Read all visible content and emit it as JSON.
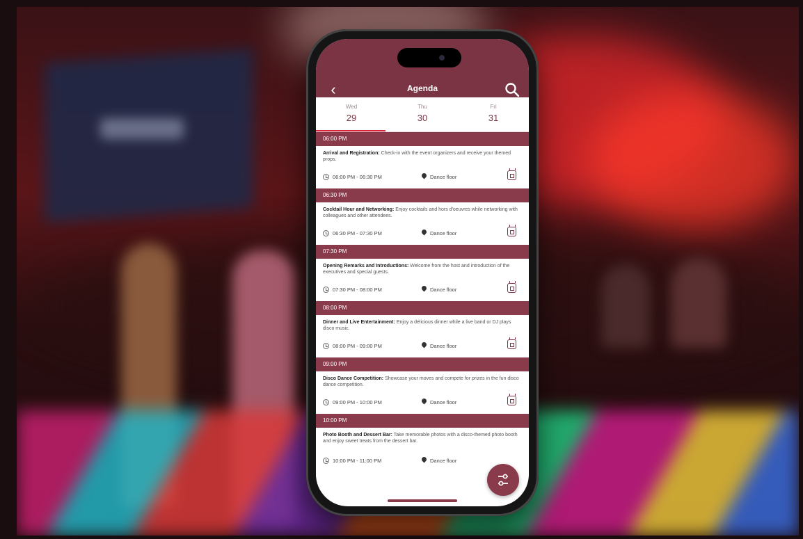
{
  "app": {
    "title": "Agenda",
    "accent_color": "#7a3443",
    "section_color": "#8a3b4b",
    "icons": {
      "back": "chevron-left-icon",
      "search": "search-icon",
      "clock": "clock-icon",
      "location": "location-pin-icon",
      "calendar": "calendar-add-icon",
      "fab": "filter-sliders-icon"
    }
  },
  "days": [
    {
      "name": "Wed",
      "date": "29",
      "active": true
    },
    {
      "name": "Thu",
      "date": "30",
      "active": false
    },
    {
      "name": "Fri",
      "date": "31",
      "active": false
    }
  ],
  "agenda": [
    {
      "header": "06:00 PM",
      "title": "Arrival and Registration:",
      "desc": "Check-in with the event organizers and receive your themed props.",
      "time": "06:00 PM - 06:30 PM",
      "location": "Dance floor"
    },
    {
      "header": "06:30 PM",
      "title": "Cocktail Hour and Networking:",
      "desc": "Enjoy cocktails and hors d'oeuvres while networking with colleagues and other attendees.",
      "time": "06:30 PM - 07:30 PM",
      "location": "Dance floor"
    },
    {
      "header": "07:30 PM",
      "title": "Opening Remarks and Introductions:",
      "desc": "Welcome from the host and introduction of the executives and special guests.",
      "time": "07:30 PM - 08:00 PM",
      "location": "Dance floor"
    },
    {
      "header": "08:00 PM",
      "title": "Dinner and Live Entertainment:",
      "desc": "Enjoy a delicious dinner while a live band or DJ plays disco music.",
      "time": "08:00 PM - 09:00 PM",
      "location": "Dance floor"
    },
    {
      "header": "09:00 PM",
      "title": "Disco Dance Competition:",
      "desc": "Showcase your moves and compete for prizes in the fun disco dance competition.",
      "time": "09:00 PM - 10:00 PM",
      "location": "Dance floor"
    },
    {
      "header": "10:00 PM",
      "title": "Photo Booth and Dessert Bar:",
      "desc": "Take memorable photos with a disco-themed photo booth and enjoy sweet treats from the dessert bar.",
      "time": "10:00 PM - 11:00 PM",
      "location": "Dance floor"
    }
  ]
}
